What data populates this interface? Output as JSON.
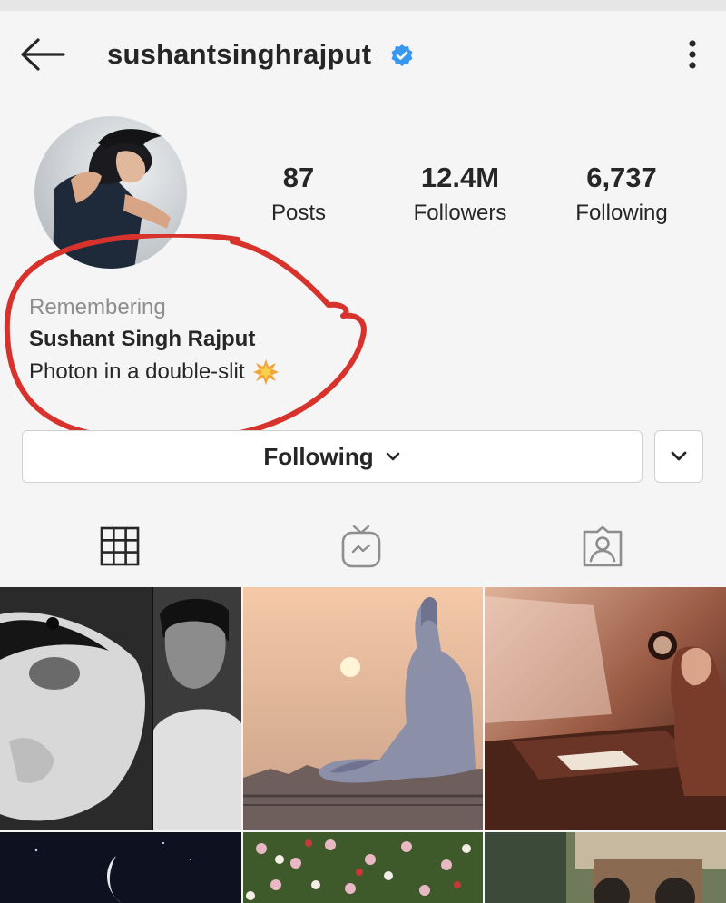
{
  "header": {
    "username": "sushantsinghrajput",
    "verified": true,
    "back_icon": "arrow-left-icon",
    "more_icon": "more-vertical-icon"
  },
  "profile": {
    "stats": [
      {
        "value": "87",
        "label": "Posts"
      },
      {
        "value": "12.4M",
        "label": "Followers"
      },
      {
        "value": "6,737",
        "label": "Following"
      }
    ],
    "bio": {
      "remembering": "Remembering",
      "name": "Sushant Singh Rajput",
      "tagline": "Photon in a double-slit"
    }
  },
  "actions": {
    "following_label": "Following"
  },
  "tabs": [
    {
      "name": "grid",
      "icon": "grid-icon",
      "active": true
    },
    {
      "name": "igtv",
      "icon": "igtv-icon",
      "active": false
    },
    {
      "name": "tagged",
      "icon": "tagged-icon",
      "active": false
    }
  ],
  "colors": {
    "verified_blue": "#3897f0",
    "annotation_red": "#d8322c",
    "text_dark": "#262626",
    "text_muted": "#8e8e8e"
  }
}
